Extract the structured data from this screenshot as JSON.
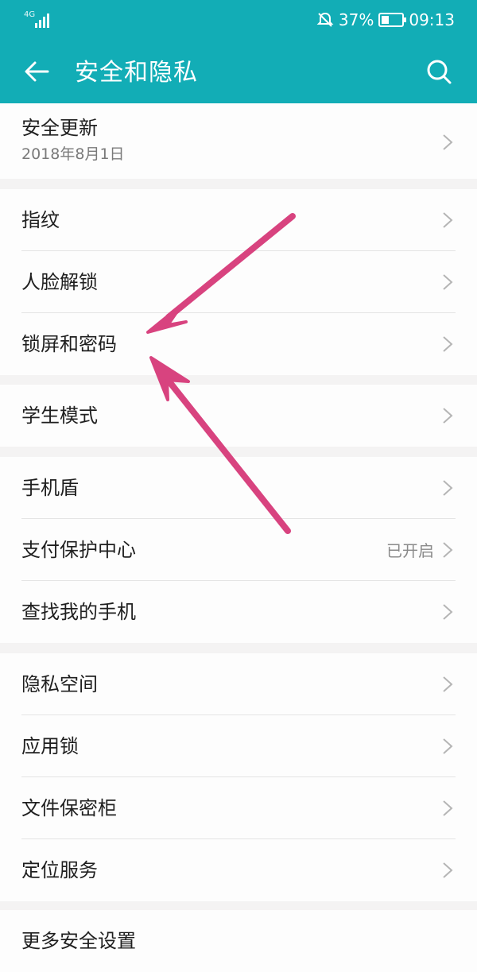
{
  "status_bar": {
    "network": "4G",
    "battery_text": "37%",
    "battery_level": 0.37,
    "time": "09:13",
    "icons": [
      "signal-icon",
      "mute-icon",
      "battery-icon"
    ]
  },
  "header": {
    "title": "安全和隐私",
    "back_icon": "back-arrow-icon",
    "search_icon": "search-icon"
  },
  "colors": {
    "header_bg": "#12adb6",
    "annotation_arrow": "#d8437f"
  },
  "groups": [
    {
      "items": [
        {
          "label": "安全更新",
          "subtitle": "2018年8月1日"
        }
      ]
    },
    {
      "items": [
        {
          "label": "指纹"
        },
        {
          "label": "人脸解锁"
        },
        {
          "label": "锁屏和密码"
        }
      ]
    },
    {
      "items": [
        {
          "label": "学生模式"
        }
      ]
    },
    {
      "items": [
        {
          "label": "手机盾"
        },
        {
          "label": "支付保护中心",
          "value": "已开启"
        },
        {
          "label": "查找我的手机"
        }
      ]
    },
    {
      "items": [
        {
          "label": "隐私空间"
        },
        {
          "label": "应用锁"
        },
        {
          "label": "文件保密柜"
        },
        {
          "label": "定位服务"
        }
      ]
    },
    {
      "items": [
        {
          "label": "更多安全设置"
        }
      ]
    }
  ]
}
